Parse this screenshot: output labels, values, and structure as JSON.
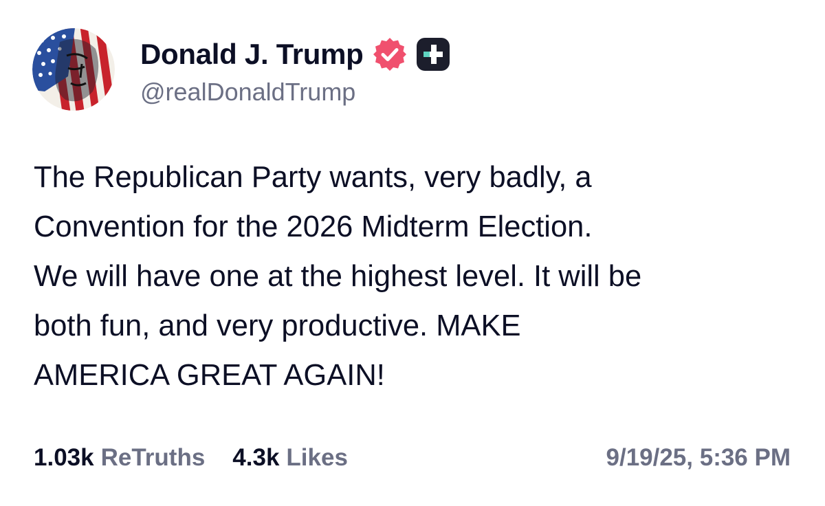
{
  "author": {
    "display_name": "Donald J. Trump",
    "handle": "@realDonaldTrump",
    "avatar_icon": "flag-portrait-avatar",
    "verified_icon": "verified-badge-icon",
    "verified_color": "#f0506e",
    "plus_icon": "plus-badge-icon",
    "plus_color": "#1c1e2c",
    "plus_accent": "#5fd4c1"
  },
  "post": {
    "text": "The Republican Party wants, very badly, a\nConvention for the 2026 Midterm Election.\nWe will have one at the highest level. It will be\nboth fun, and very productive. MAKE\nAMERICA GREAT AGAIN!"
  },
  "stats": {
    "retruths_count": "1.03k",
    "retruths_label": "ReTruths",
    "likes_count": "4.3k",
    "likes_label": "Likes"
  },
  "timestamp": "9/19/25, 5:36 PM",
  "colors": {
    "text_primary": "#0c0f25",
    "text_secondary": "#6b6f84",
    "background": "#ffffff"
  }
}
